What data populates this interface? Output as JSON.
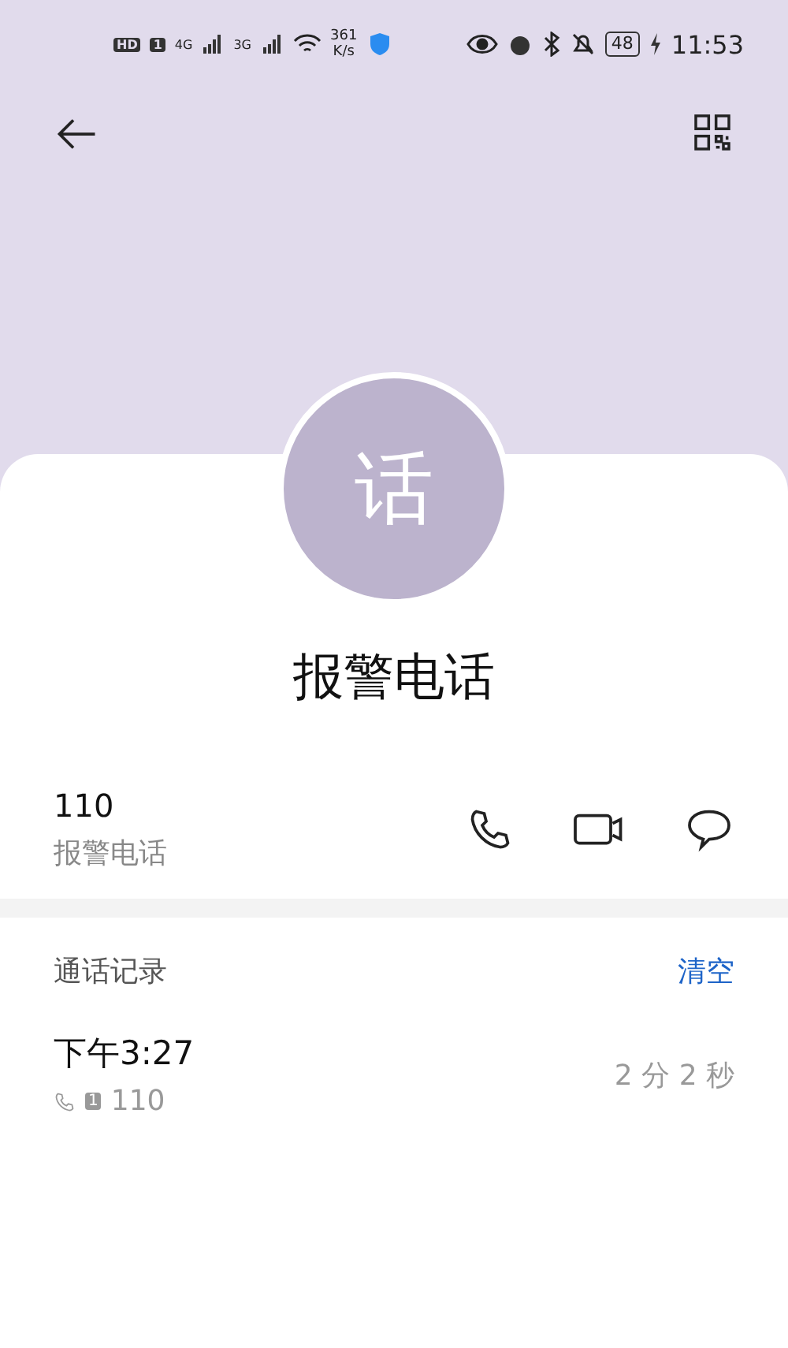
{
  "status_bar": {
    "badges": [
      "HD",
      "1"
    ],
    "networks": [
      "4G",
      "3G"
    ],
    "speed": [
      "361",
      "K/s"
    ],
    "battery": "48",
    "time": "11:53"
  },
  "contact": {
    "avatar_letter": "话",
    "name": "报警电话"
  },
  "number": {
    "value": "110",
    "label": "报警电话"
  },
  "call_log": {
    "title": "通话记录",
    "clear": "清空",
    "entries": [
      {
        "time": "下午3:27",
        "sim": "1",
        "number": "110",
        "duration": "2 分 2 秒"
      }
    ]
  }
}
